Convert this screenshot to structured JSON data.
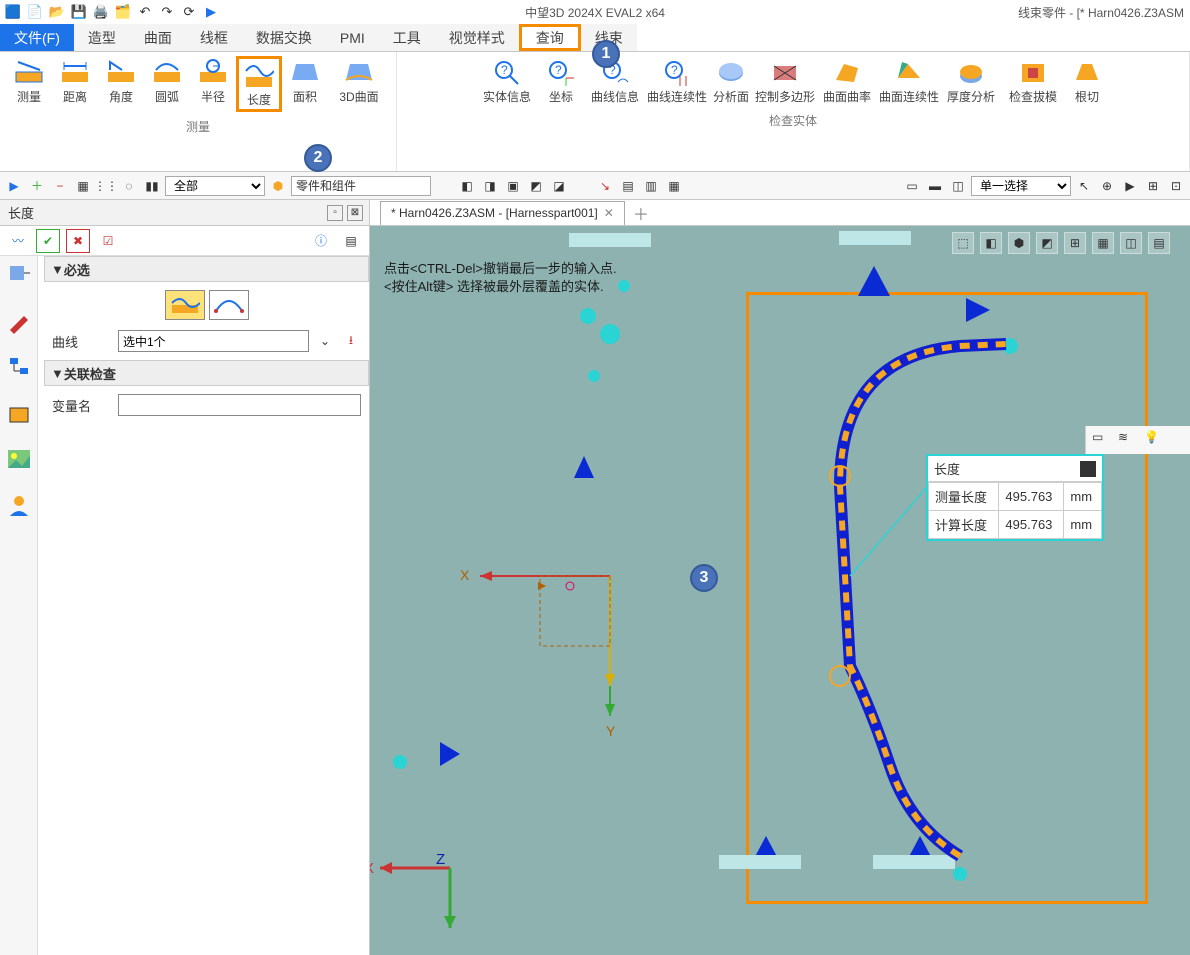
{
  "app_title": "中望3D 2024X EVAL2 x64",
  "doc_title": "线束零件 - [* Harn0426.Z3ASM",
  "menubar": {
    "file": "文件(F)",
    "items": [
      "造型",
      "曲面",
      "线框",
      "数据交换",
      "PMI",
      "工具",
      "视觉样式",
      "查询",
      "线束"
    ]
  },
  "ribbon": {
    "group1_label": "测量",
    "group2_label": "检查实体",
    "btns1": [
      "测量",
      "距离",
      "角度",
      "圆弧",
      "半径",
      "长度",
      "面积",
      "3D曲面"
    ],
    "btns2": [
      "实体信息",
      "坐标",
      "曲线信息",
      "曲线连续性",
      "分析面",
      "控制多边形",
      "曲面曲率",
      "曲面连续性",
      "厚度分析",
      "检查拔模",
      "根切"
    ]
  },
  "toolbar": {
    "filter_all": "全部",
    "parts_combo": "零件和组件",
    "sel_mode": "单一选择"
  },
  "panel": {
    "title": "长度",
    "sect1": "必选",
    "curve_label": "曲线",
    "curve_value": "选中1个",
    "sect2": "关联检查",
    "var_label": "变量名"
  },
  "doc_tab": "* Harn0426.Z3ASM - [Harnesspart001]",
  "hint_l1": "点击<CTRL-Del>撤销最后一步的输入点.",
  "hint_l2": "<按住Alt键> 选择被最外层覆盖的实体.",
  "meas": {
    "title": "长度",
    "row1_label": "测量长度",
    "row1_val": "495.763",
    "row1_unit": "mm",
    "row2_label": "计算长度",
    "row2_val": "495.763",
    "row2_unit": "mm"
  },
  "callouts": {
    "c1": "1",
    "c2": "2",
    "c3": "3"
  },
  "axis": {
    "x": "X",
    "y": "Y",
    "x2": "X",
    "z": "Z"
  }
}
